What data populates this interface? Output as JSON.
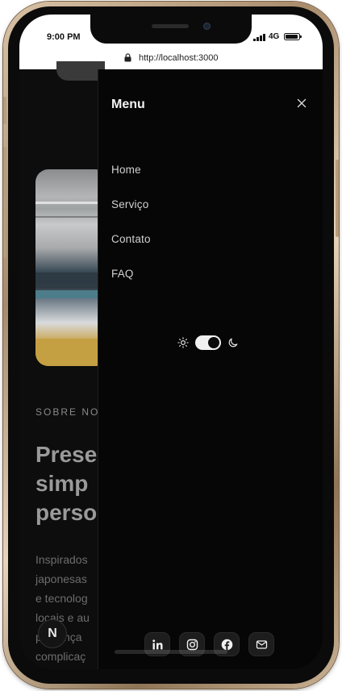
{
  "status_bar": {
    "time": "9:00 PM",
    "network": "4G"
  },
  "browser": {
    "url": "http://localhost:3000"
  },
  "background_page": {
    "section_label": "SOBRE NO",
    "headline_lines": [
      "Prese",
      "simp",
      "perso"
    ],
    "paragraph_lines": [
      "Inspirados",
      "japonesas",
      "e tecnolog",
      "locais e au",
      "presença",
      "complicaç"
    ],
    "logo_letter": "N"
  },
  "menu": {
    "title": "Menu",
    "close_icon": "close-icon",
    "items": [
      {
        "label": "Home"
      },
      {
        "label": "Serviço"
      },
      {
        "label": "Contato"
      },
      {
        "label": "FAQ"
      }
    ],
    "theme_toggle": {
      "light_icon": "sun-icon",
      "dark_icon": "moon-icon",
      "state": "dark"
    },
    "socials": [
      {
        "icon": "linkedin-icon"
      },
      {
        "icon": "instagram-icon"
      },
      {
        "icon": "facebook-icon"
      },
      {
        "icon": "mail-icon"
      }
    ]
  },
  "colors": {
    "drawer_bg": "#060606",
    "text_primary": "#f2f2f2",
    "frame_gold": "#c9b193"
  }
}
